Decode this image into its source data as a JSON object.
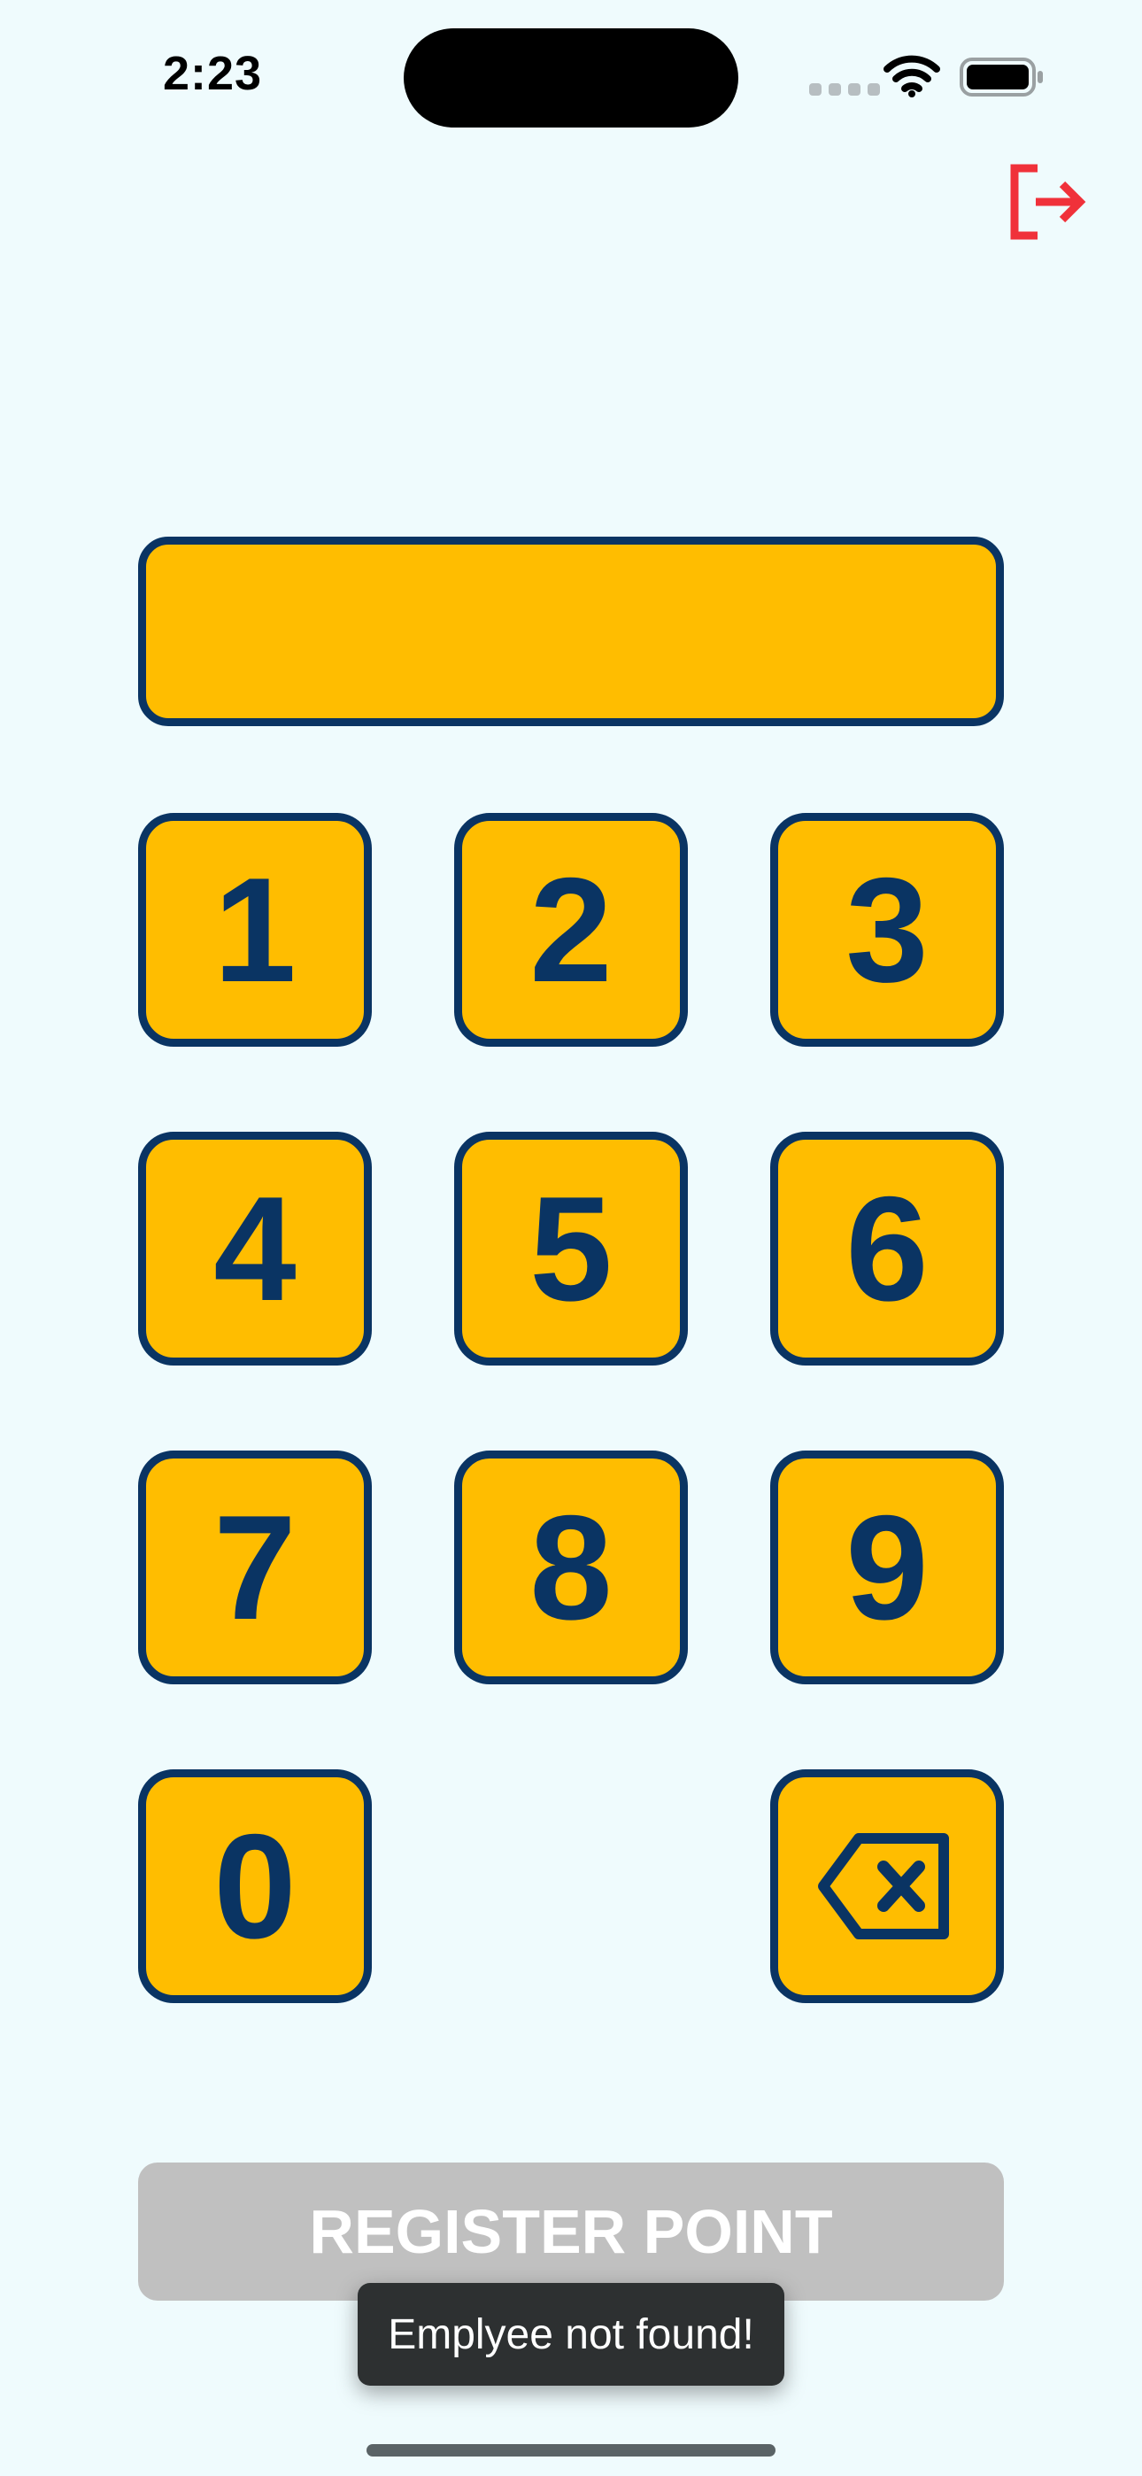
{
  "status_bar": {
    "time": "2:23"
  },
  "icons": {
    "logout": "logout-icon",
    "backspace": "backspace-icon",
    "wifi": "wifi-icon",
    "battery": "battery-icon"
  },
  "colors": {
    "background": "#EFFBFD",
    "key_fill": "#FFBD00",
    "key_border": "#0A3463",
    "logout": "#F0313A",
    "register_disabled": "#C0C0C0",
    "toast": "#2D3031"
  },
  "pin_display": {
    "value": ""
  },
  "keypad": {
    "keys": [
      "1",
      "2",
      "3",
      "4",
      "5",
      "6",
      "7",
      "8",
      "9",
      "0"
    ]
  },
  "register_button": {
    "label": "REGISTER POINT",
    "enabled": false
  },
  "toast": {
    "message": "Emplyee not found!"
  }
}
